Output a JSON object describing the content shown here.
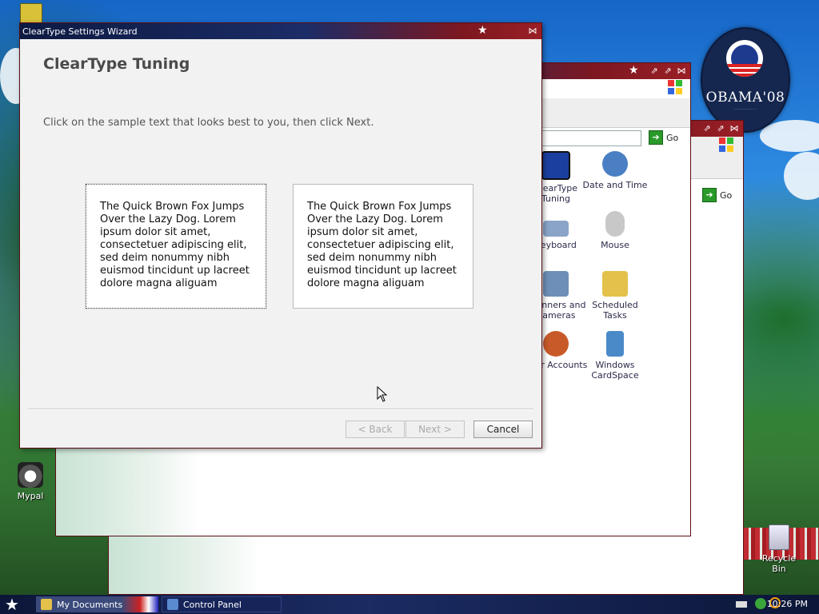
{
  "wizard": {
    "window_title": "ClearType Settings Wizard",
    "heading": "ClearType Tuning",
    "instruction": "Click on the sample text that looks best to you, then click Next.",
    "samples": [
      "The Quick Brown Fox Jumps Over the Lazy Dog. Lorem ipsum dolor sit amet, consectetuer adipiscing elit, sed deim nonummy nibh euismod tincidunt up lacreet dolore magna aliguam",
      "The Quick Brown Fox Jumps Over the Lazy Dog. Lorem ipsum dolor sit amet, consectetuer adipiscing elit, sed deim nonummy nibh euismod tincidunt up lacreet dolore magna aliguam"
    ],
    "back_label": "< Back",
    "next_label": "Next >",
    "cancel_label": "Cancel"
  },
  "control_panel": {
    "go_label": "Go",
    "items": [
      {
        "label": "ClearType Tuning",
        "icon": "cleartype-icon",
        "color": "#1b3f9e"
      },
      {
        "label": "Date and Time",
        "icon": "clock-icon",
        "color": "#4a7fc4"
      },
      {
        "label": "Keyboard",
        "icon": "keyboard-icon",
        "color": "#8aa4c8"
      },
      {
        "label": "Mouse",
        "icon": "mouse-icon",
        "color": "#c8c8c8"
      },
      {
        "label": "Scanners and Cameras",
        "icon": "scanner-icon",
        "color": "#6e8fb8"
      },
      {
        "label": "Scheduled Tasks",
        "icon": "folder-clock-icon",
        "color": "#e3c14a"
      },
      {
        "label": "User Accounts",
        "icon": "users-icon",
        "color": "#c85a2a"
      },
      {
        "label": "Windows CardSpace",
        "icon": "cardspace-icon",
        "color": "#4a8ac8"
      }
    ]
  },
  "second_window": {
    "go_label": "Go"
  },
  "desktop": {
    "icons": [
      {
        "label": "Mypal",
        "icon": "raccoon-icon"
      },
      {
        "label": "Recycle Bin",
        "icon": "recycle-bin-icon"
      }
    ],
    "wallpaper_logo_text": "OBAMA'08"
  },
  "taskbar": {
    "items": [
      {
        "label": "My Documents",
        "icon": "folder-icon"
      },
      {
        "label": "Control Panel",
        "icon": "control-panel-icon"
      }
    ],
    "clock": "10:26 PM"
  },
  "colors": {
    "title_blue": "#0d1a42",
    "title_red": "#9a1f26",
    "wizard_bg": "#f2f2f2"
  }
}
